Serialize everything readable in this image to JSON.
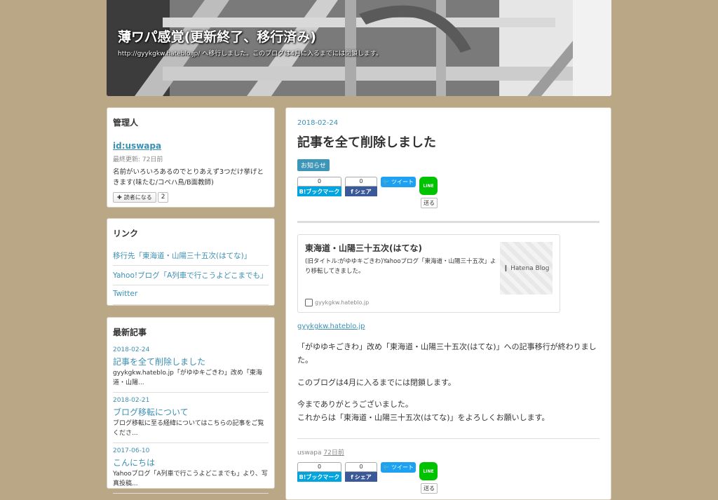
{
  "header": {
    "title": "薄ワパ感覚(更新終了、移行済み)",
    "description": "http://gyykgkw.hateblo.jp/ へ移行しました。このブログは4月に入るまでには閉鎖します。"
  },
  "profile": {
    "heading": "管理人",
    "user_id": "id:uswapa",
    "last_update": "最終更新: 72日前",
    "intro": "名前がいろいろあるのでとりあえず3つだけ挙げときます(味たむ/コペハ鳥/B面教師)",
    "reader_button": "読者になる",
    "reader_count": "2"
  },
  "links": {
    "heading": "リンク",
    "items": [
      "移行先「東海道・山陽三十五次(はてな)」",
      "Yahoo!ブログ「A列車で行こうよどこまでも」",
      "Twitter"
    ]
  },
  "recent": {
    "heading": "最新記事",
    "entries": [
      {
        "date": "2018-02-24",
        "title": "記事を全て削除しました",
        "summary": "gyykgkw.hateblo.jp「がゆゆキごきわ」改め「東海道・山陽..."
      },
      {
        "date": "2018-02-21",
        "title": "ブログ移転について",
        "summary": "ブログ移転に至る経緯についてはこちらの記事をご覧くださ..."
      },
      {
        "date": "2017-06-10",
        "title": "こんにちは",
        "summary": "Yahooブログ「A列車で行こうよどこまでも」より、写真投稿..."
      }
    ]
  },
  "article": {
    "date": "2018-02-24",
    "title": "記事を全て削除しました",
    "category": "お知らせ",
    "share": {
      "hatena_count": "0",
      "hatena_label": "B!ブックマーク",
      "fb_count": "0",
      "fb_label": "シェア",
      "tweet_label": "ツイート",
      "line_icon": "LINE",
      "line_send": "送る"
    },
    "embed": {
      "title": "東海道・山陽三十五次(はてな)",
      "description": "(旧タイトル:がゆゆキごきわ)Yahooブログ「東海道・山陽三十五次」より移転してきました。",
      "thumb_label": "Hatena Blog",
      "site": "gyykgkw.hateblo.jp"
    },
    "source_link": "gyykgkw.hateblo.jp",
    "paragraphs": [
      "「がゆゆキごきわ」改め「東海道・山陽三十五次(はてな)」への記事移行が終わりました。",
      "このブログは4月に入るまでには閉鎖します。",
      "今までありがとうございました。",
      "これからは「東海道・山陽三十五次(はてな)」をよろしくお願いします。"
    ],
    "footer_author": "uswapa",
    "footer_time": "72日前"
  }
}
